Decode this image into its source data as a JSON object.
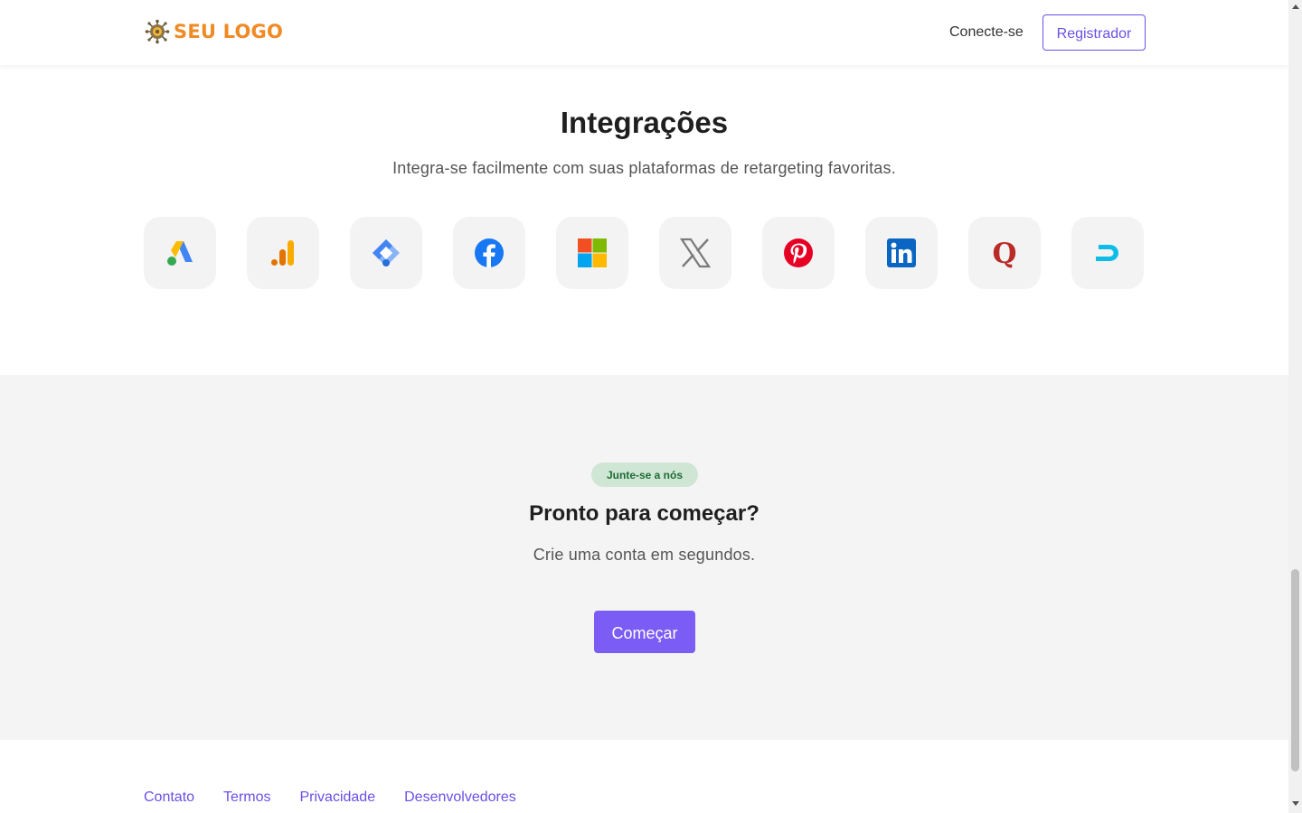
{
  "header": {
    "logo_text": "SEU LOGO",
    "logo_icon": "cog-network-icon",
    "login_label": "Conecte-se",
    "register_label": "Registrador"
  },
  "integrations": {
    "title": "Integrações",
    "subtitle": "Integra-se facilmente com suas plataformas de retargeting favoritas.",
    "platforms": [
      {
        "icon": "google-ads-icon"
      },
      {
        "icon": "google-analytics-icon"
      },
      {
        "icon": "google-tag-manager-icon"
      },
      {
        "icon": "facebook-icon"
      },
      {
        "icon": "microsoft-icon"
      },
      {
        "icon": "x-twitter-icon"
      },
      {
        "icon": "pinterest-icon"
      },
      {
        "icon": "linkedin-icon"
      },
      {
        "icon": "quora-icon"
      },
      {
        "icon": "adroll-icon"
      }
    ]
  },
  "cta": {
    "badge": "Junte-se a nós",
    "title": "Pronto para começar?",
    "subtitle": "Crie uma conta em segundos.",
    "button_label": "Começar"
  },
  "footer": {
    "links": [
      "Contato",
      "Termos",
      "Privacidade",
      "Desenvolvedores"
    ]
  },
  "colors": {
    "accent": "#6d4fe6",
    "cta_button": "#7b5cf5",
    "logo": "#f08a24",
    "badge_bg": "#cfe6d4",
    "badge_text": "#1c6b34",
    "cta_bg": "#f4f4f4"
  }
}
